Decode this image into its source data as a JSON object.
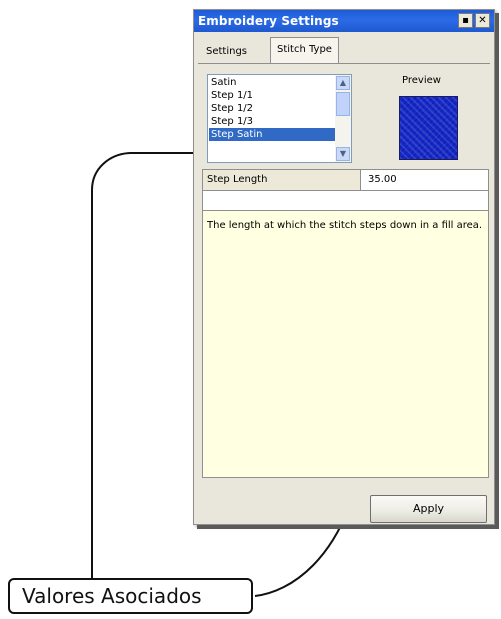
{
  "window": {
    "title": "Embroidery Settings",
    "pin_icon": "pin-icon",
    "close_icon": "close-icon",
    "pin_glyph": "▪",
    "close_glyph": "✕"
  },
  "tabs": [
    {
      "label": "Settings"
    },
    {
      "label": "Stitch Type"
    }
  ],
  "stitch_list": {
    "items": [
      "Satin",
      "Step 1/1",
      "Step 1/2",
      "Step 1/3",
      "Step Satin"
    ],
    "selected": "Step Satin"
  },
  "preview": {
    "label": "Preview",
    "swatch_color": "#1428c8"
  },
  "property": {
    "name": "Step Length",
    "value": "35.00"
  },
  "description": "The length at which the stitch steps down in a fill area.",
  "apply_label": "Apply",
  "annotation": {
    "label": "Valores Asociados"
  }
}
